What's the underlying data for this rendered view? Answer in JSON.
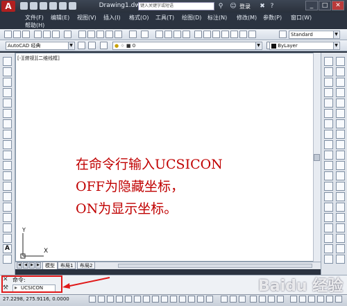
{
  "window": {
    "title": "Drawing1.dwg",
    "search_placeholder": "键入关键字或短语",
    "login": "登录",
    "app_letter": "A"
  },
  "menu": {
    "items": [
      "文件(F)",
      "编辑(E)",
      "视图(V)",
      "插入(I)",
      "格式(O)",
      "工具(T)",
      "绘图(D)",
      "标注(N)",
      "修改(M)",
      "参数(P)",
      "窗口(W)"
    ],
    "help": "帮助(H)"
  },
  "toolbar": {
    "workspace": "AutoCAD 经典",
    "layer": "0",
    "text_style": "Standard",
    "color": "ByLayer"
  },
  "viewport": {
    "label": "[-][俯视][二维线框]",
    "axis_y": "Y",
    "axis_x": "X"
  },
  "message": {
    "line1": "在命令行输入UCSICON",
    "line2": "OFF为隐藏坐标，",
    "line3": "ON为显示坐标。"
  },
  "layout_tabs": [
    "模型",
    "布局1",
    "布局2"
  ],
  "command": {
    "history": "命令:",
    "input": "UCSICON"
  },
  "status": {
    "coords": "27.2298, 275.9116, 0.0000"
  },
  "watermark": "Baidu 经验",
  "colors": {
    "accent_red": "#c00000",
    "highlight_box": "#e01818",
    "frame": "#2b3340"
  }
}
